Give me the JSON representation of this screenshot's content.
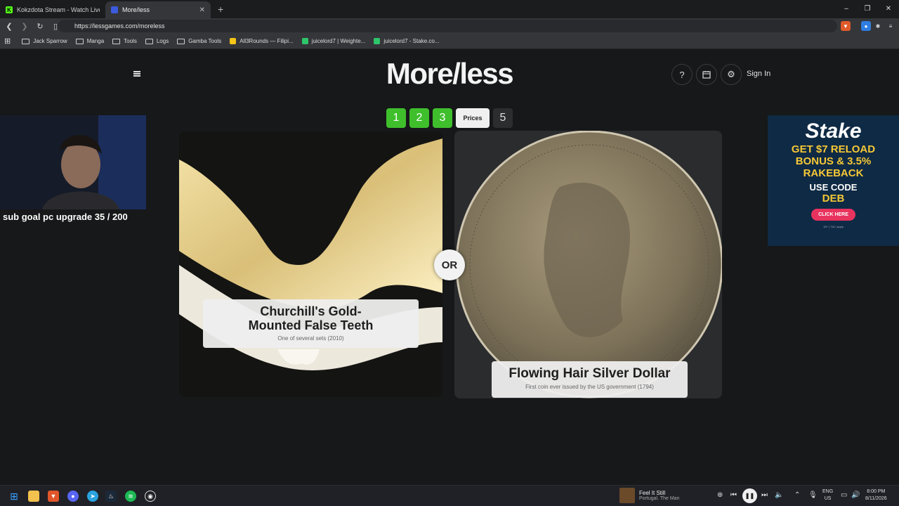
{
  "browser": {
    "tabs": [
      {
        "title": "Kokzdota Stream - Watch Live on Kick",
        "favicon_color": "#53fc18",
        "favicon_letter": "K"
      },
      {
        "title": "More/less",
        "favicon_color": "#3b5bdb",
        "favicon_letter": ""
      }
    ],
    "new_tab": "+",
    "window_controls": {
      "minimize": "–",
      "maximize": "❐",
      "close": "✕"
    },
    "url": "https://lessgames.com/moreless",
    "bookmarks": [
      {
        "label": "Jack Sparrow",
        "type": "folder"
      },
      {
        "label": "Manga",
        "type": "folder"
      },
      {
        "label": "Tools",
        "type": "folder"
      },
      {
        "label": "Logs",
        "type": "folder"
      },
      {
        "label": "Gamba Tools",
        "type": "folder"
      },
      {
        "label": "All3Rounds — Filipi...",
        "type": "link",
        "color": "#f5c518"
      },
      {
        "label": "juicelord7 | Weighte...",
        "type": "link",
        "color": "#2ec56b"
      },
      {
        "label": "juicelord7 - Stake.co...",
        "type": "link",
        "color": "#2ec56b"
      }
    ]
  },
  "site": {
    "logo": "More/less",
    "help": "?",
    "sign_in": "Sign In",
    "steps": [
      "1",
      "2",
      "3",
      "Prices",
      "5"
    ],
    "left_card": {
      "title": "Churchill's Gold-Mounted False Teeth",
      "subtitle": "One of several sets (2010)"
    },
    "right_card": {
      "title": "Flowing Hair Silver Dollar",
      "subtitle": "First coin ever issued by the US government (1794)"
    },
    "or_label": "OR"
  },
  "overlay": {
    "sub_goal": "sub goal pc upgrade 35 / 200"
  },
  "ad": {
    "brand": "Stake",
    "line1": "GET $7 RELOAD",
    "line2": "BONUS & 3.5%",
    "line3": "RAKEBACK",
    "use_code": "USE CODE",
    "code": "DEB",
    "button": "CLICK HERE",
    "fine_print": "18+ | T&C apply"
  },
  "taskbar": {
    "song_title": "Feel It Still",
    "song_artist": "Portugal. The Man",
    "lang": "ENG",
    "region": "US",
    "time": "8:00 PM",
    "date": "8/11/2026"
  },
  "colors": {
    "step_done": "#3fbf2c",
    "accent_green": "#53fc18"
  }
}
